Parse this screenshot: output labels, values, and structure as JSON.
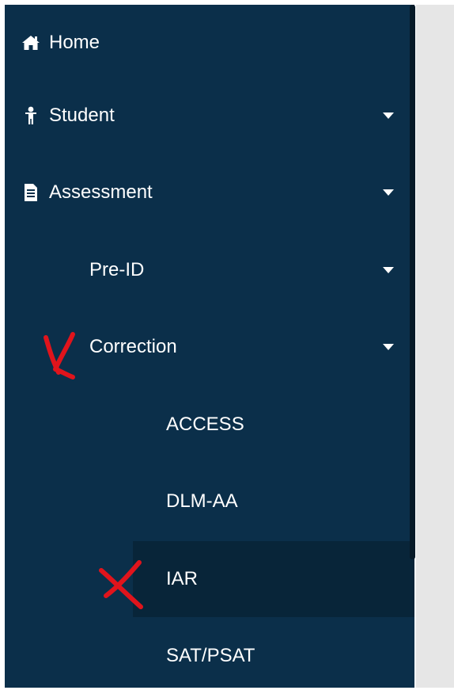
{
  "colors": {
    "sidebar_bg": "#0b2f4a",
    "active_bg": "#082539",
    "text": "#ffffff",
    "annotation": "#e0141c",
    "content_bg": "#e6e6e6"
  },
  "nav": {
    "home": {
      "label": "Home",
      "icon": "home-icon"
    },
    "student": {
      "label": "Student",
      "icon": "person-icon"
    },
    "assessment": {
      "label": "Assessment",
      "icon": "document-icon"
    },
    "pre_id": {
      "label": "Pre-ID"
    },
    "correction": {
      "label": "Correction"
    },
    "access": {
      "label": "ACCESS"
    },
    "dlm_aa": {
      "label": "DLM-AA"
    },
    "iar": {
      "label": "IAR",
      "active": true
    },
    "sat_psat": {
      "label": "SAT/PSAT"
    }
  }
}
